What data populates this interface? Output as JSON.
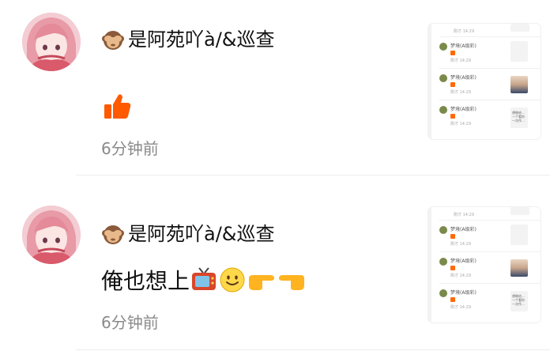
{
  "comments": [
    {
      "username": "是阿苑吖à/&巡查",
      "content_text": "",
      "content_emoji": [
        "thumbs-up-icon"
      ],
      "time": "6分钟前"
    },
    {
      "username": "是阿苑吖à/&巡查",
      "content_text": "俺也想上",
      "content_emoji": [
        "tv-icon",
        "smile-icon",
        "pointing-right-icon",
        "pointing-left-icon"
      ],
      "time": "6分钟前"
    }
  ],
  "thumbnail": {
    "items": [
      {
        "name": "梦境(A级彩)",
        "time": "刚才 14:29",
        "card": "blank"
      },
      {
        "name": "梦境(A级彩)",
        "time": "刚才 14:29",
        "card": "photo"
      },
      {
        "name": "梦境(A级彩)",
        "time": "刚才 14:29",
        "card": "text",
        "card_text": "想做给…\n一个看你\n一次作…"
      }
    ],
    "header": "刚才 14:29"
  },
  "colors": {
    "timestamp": "#8a8a8a",
    "like_orange": "#ff5a00",
    "divider": "#ececec"
  }
}
